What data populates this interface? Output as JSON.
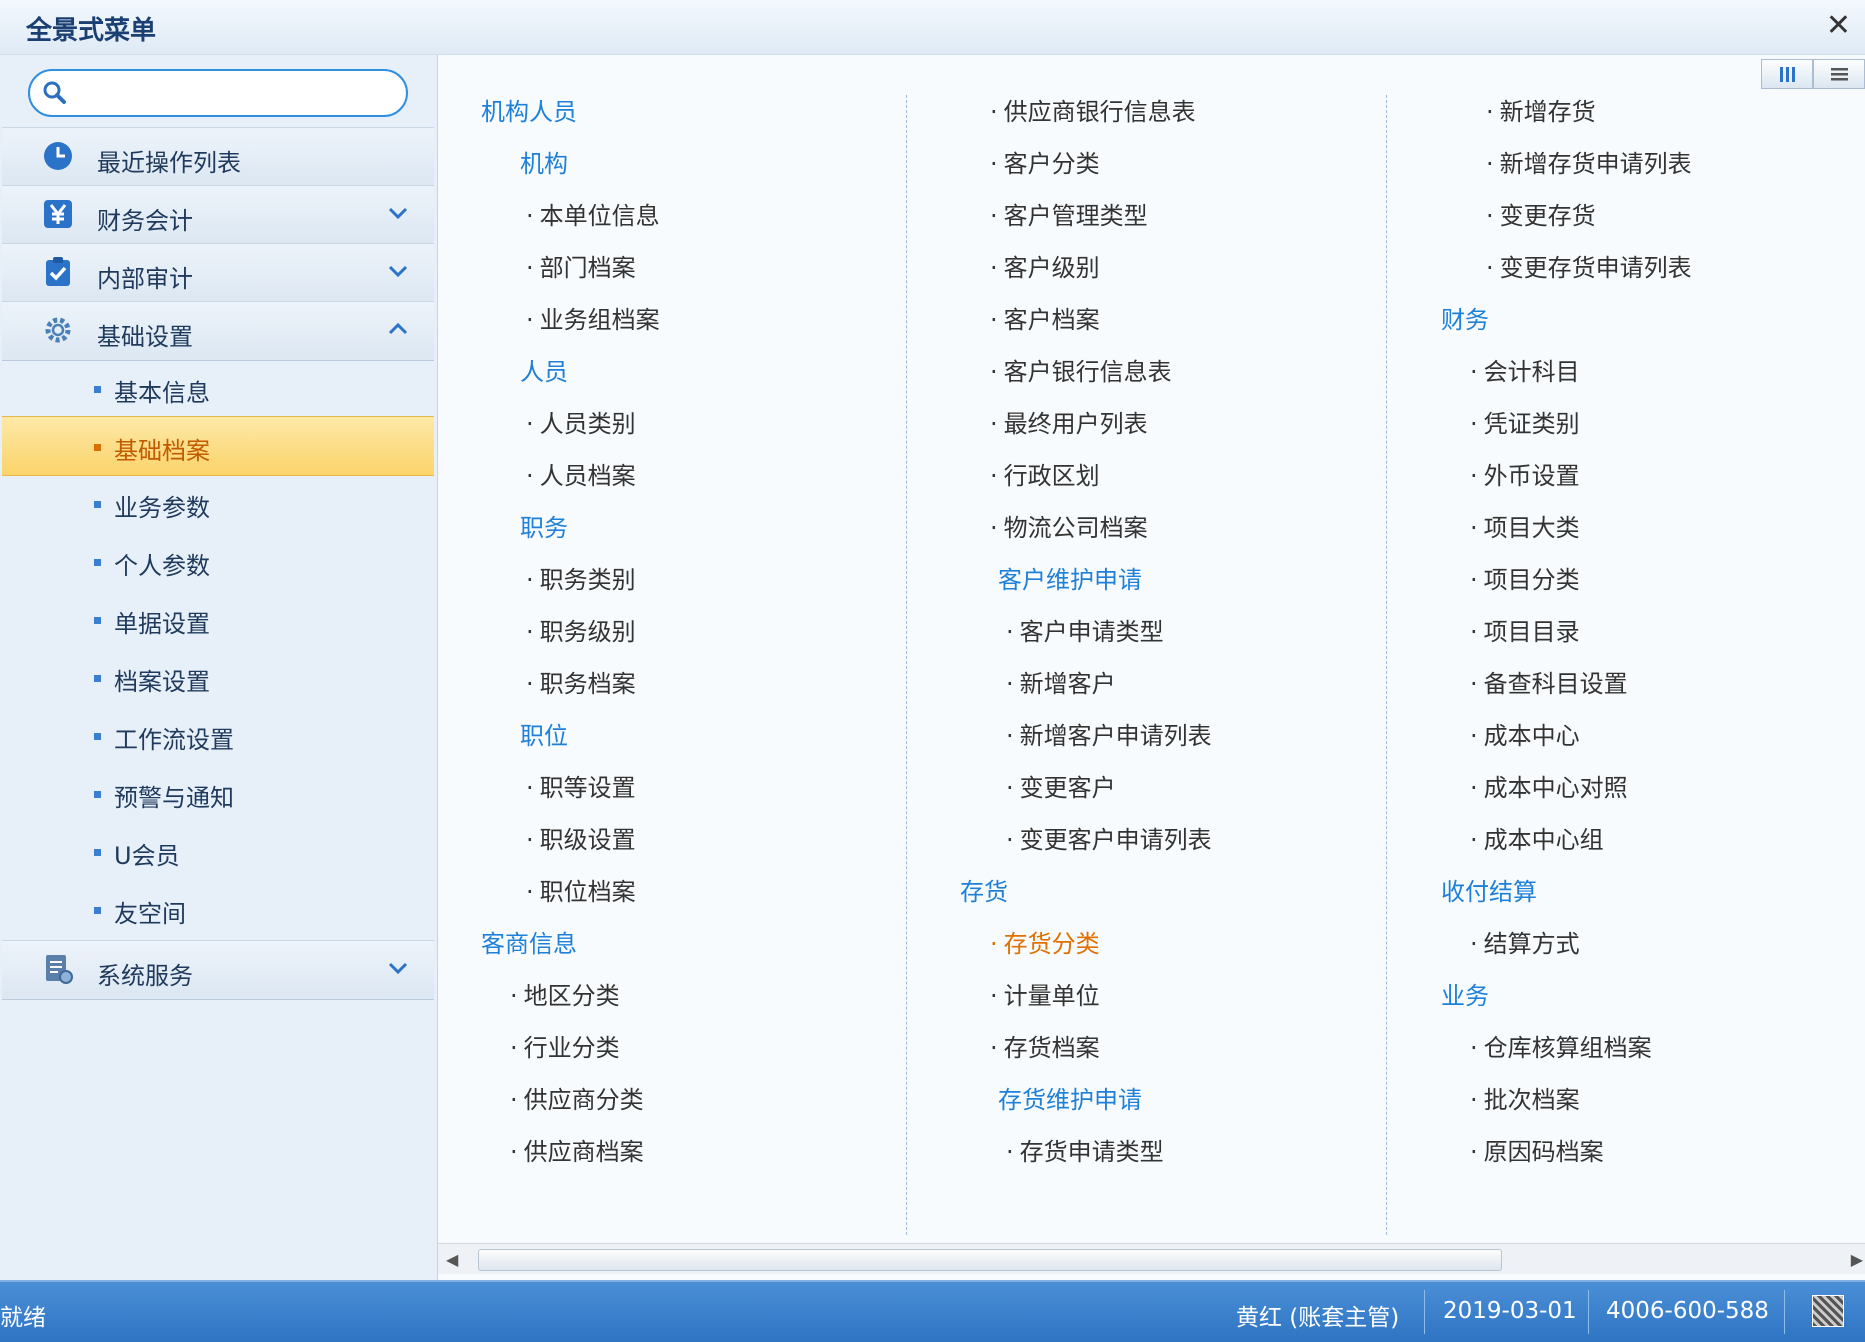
{
  "window": {
    "title": "全景式菜单"
  },
  "search": {
    "placeholder": ""
  },
  "sidebar": {
    "top_items": [
      {
        "label": "最近操作列表"
      },
      {
        "label": "财务会计"
      },
      {
        "label": "内部审计"
      },
      {
        "label": "基础设置"
      }
    ],
    "sub_items": [
      "基本信息",
      "基础档案",
      "业务参数",
      "个人参数",
      "单据设置",
      "档案设置",
      "工作流设置",
      "预警与通知",
      "U会员",
      "友空间"
    ],
    "bottom_item": {
      "label": "系统服务"
    },
    "active_sub": "基础档案"
  },
  "columns": {
    "c1": [
      "机构人员",
      "机构",
      "本单位信息",
      "部门档案",
      "业务组档案",
      "人员",
      "人员类别",
      "人员档案",
      "职务",
      "职务类别",
      "职务级别",
      "职务档案",
      "职位",
      "职等设置",
      "职级设置",
      "职位档案",
      "客商信息",
      "地区分类",
      "行业分类",
      "供应商分类",
      "供应商档案"
    ],
    "c2": [
      "供应商银行信息表",
      "客户分类",
      "客户管理类型",
      "客户级别",
      "客户档案",
      "客户银行信息表",
      "最终用户列表",
      "行政区划",
      "物流公司档案",
      "客户维护申请",
      "客户申请类型",
      "新增客户",
      "新增客户申请列表",
      "变更客户",
      "变更客户申请列表",
      "存货",
      "存货分类",
      "计量单位",
      "存货档案",
      "存货维护申请",
      "存货申请类型"
    ],
    "c3": [
      "新增存货",
      "新增存货申请列表",
      "变更存货",
      "变更存货申请列表",
      "财务",
      "会计科目",
      "凭证类别",
      "外币设置",
      "项目大类",
      "项目分类",
      "项目目录",
      "备查科目设置",
      "成本中心",
      "成本中心对照",
      "成本中心组",
      "收付结算",
      "结算方式",
      "业务",
      "仓库核算组档案",
      "批次档案",
      "原因码档案"
    ]
  },
  "status": {
    "ready": "就绪",
    "user": "黄红 (账套主管)",
    "date": "2019-03-01",
    "phone": "4006-600-588"
  },
  "colors": {
    "accent": "#1e80d8",
    "active_text": "#e07000",
    "status_bar": "#3b80cc"
  },
  "icons": {
    "recent": "clock-icon",
    "finance": "yen-icon",
    "audit": "clipboard-check-icon",
    "settings": "gear-icon",
    "system": "document-gear-icon"
  }
}
